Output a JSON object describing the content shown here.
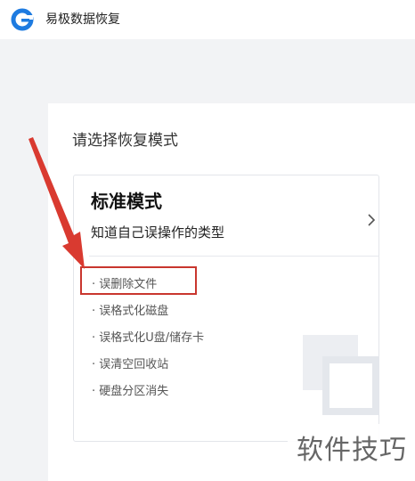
{
  "app": {
    "title": "易极数据恢复",
    "brand_color": "#1e7be0"
  },
  "panel": {
    "heading": "请选择恢复模式"
  },
  "mode_card": {
    "title": "标准模式",
    "description": "知道自己误操作的类型",
    "chevron_icon": "chevron-right-icon",
    "features": [
      "· 误删除文件",
      "· 误格式化磁盘",
      "· 误格式化U盘/储存卡",
      "· 误清空回收站",
      "· 硬盘分区消失"
    ]
  },
  "annotation": {
    "color": "#d93a30"
  },
  "watermark": {
    "text": "软件技巧"
  }
}
